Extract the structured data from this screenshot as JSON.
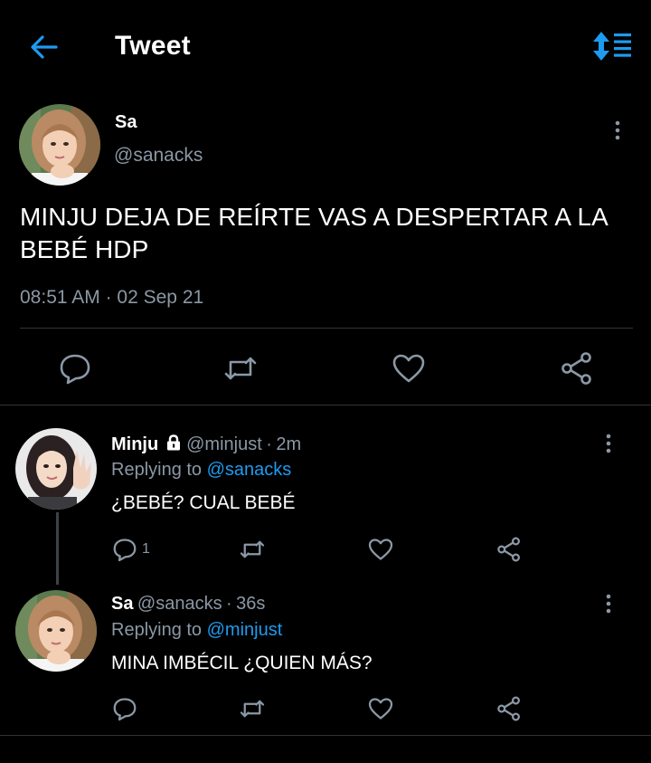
{
  "header": {
    "title": "Tweet",
    "back_icon": "arrow-left-icon",
    "sort_icon": "sort-icon",
    "accent": "#1d9bf0"
  },
  "main_tweet": {
    "name": "Sa",
    "handle": "@sanacks",
    "text": "MINJU DEJA DE REÍRTE VAS A DESPERTAR A LA BEBÉ HDP",
    "time": "08:51 AM",
    "dot": "·",
    "date": "02 Sep 21"
  },
  "replies": [
    {
      "name": "Minju",
      "lock_icon": "lock-icon",
      "handle": "@minjust",
      "dot": "·",
      "age": "2m",
      "replying_prefix": "Replying to",
      "replying_to": "@sanacks",
      "text": "¿BEBÉ? CUAL BEBÉ",
      "reply_count": "1"
    },
    {
      "name": "Sa",
      "handle": "@sanacks",
      "dot": "·",
      "age": "36s",
      "replying_prefix": "Replying to",
      "replying_to": "@minjust",
      "text": "MINA IMBÉCIL ¿QUIEN MÁS?"
    }
  ],
  "colors": {
    "background": "#000000",
    "text": "#ffffff",
    "muted": "#8b98a5",
    "separator": "#2f3336",
    "link": "#1d9bf0"
  }
}
